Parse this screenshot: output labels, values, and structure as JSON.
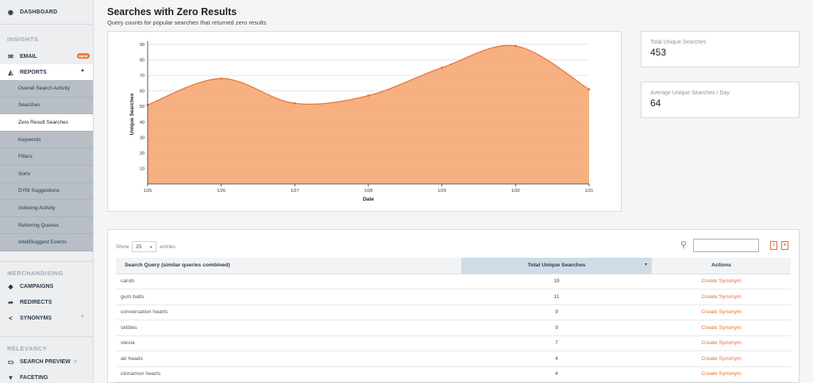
{
  "sidebar": {
    "dashboard": "DASHBOARD",
    "insights_title": "INSIGHTS",
    "email": "EMAIL",
    "email_badge": "alpha",
    "reports": "REPORTS",
    "report_items": [
      "Overall Search Activity",
      "Searches",
      "Zero Result Searches",
      "Keywords",
      "Filters",
      "Sorts",
      "DYM Suggestions",
      "Indexing Activity",
      "Referring Queries",
      "IntelliSuggest Events"
    ],
    "merch_title": "MERCHANDISING",
    "campaigns": "CAMPAIGNS",
    "redirects": "REDIRECTS",
    "synonyms": "SYNONYMS",
    "relevancy_title": "RELEVANCY",
    "search_preview": "SEARCH PREVIEW",
    "faceting": "FACETING"
  },
  "page": {
    "title": "Searches with Zero Results",
    "subtitle": "Query counts for popular searches that returned zero results"
  },
  "stats": [
    {
      "label": "Total Unique Searches",
      "value": "453"
    },
    {
      "label": "Average Unique Searches / Day",
      "value": "64"
    }
  ],
  "chart_data": {
    "type": "area",
    "x": [
      "1/25",
      "1/26",
      "1/27",
      "1/28",
      "1/29",
      "1/30",
      "1/31"
    ],
    "values": [
      51,
      68,
      52,
      57,
      75,
      89,
      61
    ],
    "xlabel": "Date",
    "ylabel": "Unique Searches",
    "ylim": [
      0,
      90
    ],
    "yticks": [
      10,
      20,
      30,
      40,
      50,
      60,
      70,
      80,
      90
    ],
    "grid": true,
    "fill_color": "#f5ac7a",
    "line_color": "#e8702f"
  },
  "table": {
    "show_label": "Show",
    "entries_value": "25",
    "entries_label": "entries",
    "columns": [
      "Search Query (similar queries combined)",
      "Total Unique Searches",
      "Actions"
    ],
    "rows": [
      {
        "query": "carob",
        "count": "18",
        "action": "Create Synonym"
      },
      {
        "query": "gum balls",
        "count": "11",
        "action": "Create Synonym"
      },
      {
        "query": "conversation hearts",
        "count": "9",
        "action": "Create Synonym"
      },
      {
        "query": "skittles",
        "count": "9",
        "action": "Create Synonym"
      },
      {
        "query": "stevia",
        "count": "7",
        "action": "Create Synonym"
      },
      {
        "query": "air heads",
        "count": "4",
        "action": "Create Synonym"
      },
      {
        "query": "cinnamon hearts",
        "count": "4",
        "action": "Create Synonym"
      }
    ]
  }
}
